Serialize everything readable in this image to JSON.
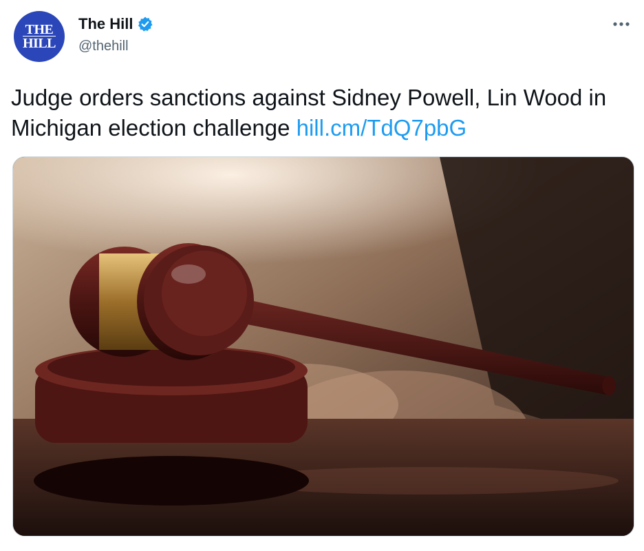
{
  "account": {
    "avatar_line1": "THE",
    "avatar_line2": "HILL",
    "name": "The Hill",
    "handle": "@thehill",
    "verified_icon": "verified-badge-icon",
    "more_icon": "more-options-icon"
  },
  "tweet": {
    "text": "Judge orders sanctions against Sidney Powell, Lin Wood in Michigan election challenge ",
    "link": "hill.cm/TdQ7pbG"
  },
  "media": {
    "icon": "gavel-photo"
  },
  "colors": {
    "avatar_bg": "#2a46b8",
    "link": "#1d9bf0",
    "verified": "#1d9bf0",
    "handle": "#536471",
    "text": "#0f1419"
  }
}
